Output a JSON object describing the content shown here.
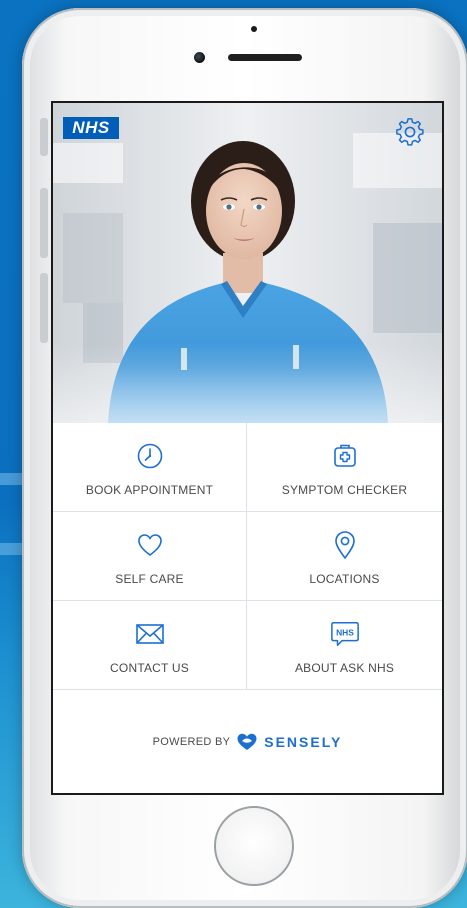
{
  "header": {
    "logo_text": "NHS",
    "settings_icon": "gear-icon"
  },
  "actions": [
    {
      "label": "BOOK APPOINTMENT",
      "icon": "clock-icon"
    },
    {
      "label": "SYMPTOM CHECKER",
      "icon": "medical-kit-icon"
    },
    {
      "label": "SELF CARE",
      "icon": "heart-icon"
    },
    {
      "label": "LOCATIONS",
      "icon": "location-pin-icon"
    },
    {
      "label": "CONTACT US",
      "icon": "envelope-icon"
    },
    {
      "label": "ABOUT ASK NHS",
      "icon": "nhs-chat-icon",
      "icon_text": "NHS"
    }
  ],
  "footer": {
    "powered_by": "POWERED BY",
    "brand": "SENSELY",
    "brand_icon": "sensely-heart-icon"
  },
  "colors": {
    "nhs_blue": "#005eb8",
    "icon_blue": "#1c6fd1",
    "background_blue": "#0a72c0",
    "scrub_blue": "#3f97d9"
  }
}
